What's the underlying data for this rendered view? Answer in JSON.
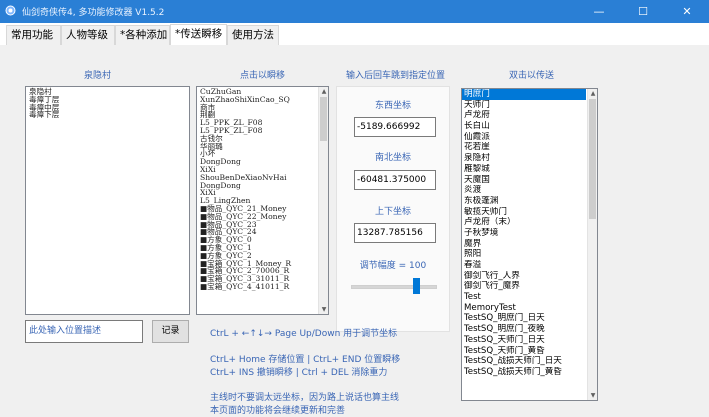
{
  "window": {
    "title": "仙剑奇侠传4, 多功能修改器  V1.5.2",
    "minimize": "—",
    "maximize": "☐",
    "close": "✕",
    "app_icon": "app-icon",
    "accent_color": "#2a7fd5"
  },
  "tabs": [
    {
      "label": "常用功能"
    },
    {
      "label": "人物等级"
    },
    {
      "label": "*各种添加"
    },
    {
      "label": "*传送瞬移"
    },
    {
      "label": "使用方法"
    }
  ],
  "headers": {
    "left": "泉隐村",
    "middle": "点击以瞬移",
    "coords": "输入后回车跳到指定位置",
    "right": "双击以传送"
  },
  "left_list": [
    "泉隐村",
    "毒瘴丁层",
    "毒瘴中层",
    "毒瘴下层"
  ],
  "middle_list": [
    "CuZhuGan",
    "XunZhaoShiXinCao_SQ",
    "商市",
    "荆蒯",
    "L5_PPK_ZL_F08",
    "L5_PPK_ZL_F08",
    "古钱尔",
    "华丽璐",
    "小坏",
    "DongDong",
    "XiXi",
    "ShouBenDeXiaoNvHai",
    "DongDong",
    "XiXi",
    "L5_LingZhen",
    "■物品_QYC_21_Money",
    "■物品_QYC_22_Money",
    "■物品_QYC_23",
    "■物品_QYC_24",
    "■方象_QYC_0",
    "■方象_QYC_1",
    "■方象_QYC_2",
    "■宝箱_QYC_1_Money_R",
    "■宝箱_QYC_2_70006_R",
    "■宝箱_QYC_3_31011_R",
    "■宝箱_QYC_4_41011_R"
  ],
  "coords": {
    "east_west_label": "东西坐标",
    "east_west_value": "-5189.666992",
    "north_south_label": "南北坐标",
    "north_south_value": "-60481.375000",
    "up_down_label": "上下坐标",
    "up_down_value": "13287.785156",
    "step_label": "调节幅度 = 100",
    "step_fraction": 0.8
  },
  "right_list": [
    "明庶门",
    "天师门",
    "卢龙府",
    "长白山",
    "仙霞派",
    "花若崖",
    "泉隐村",
    "雁黎城",
    "天魔国",
    "炎渡",
    "东极蓬渊",
    "敏揽天帅门",
    "卢龙府（末）",
    "子秋梦境",
    "魔界",
    "照阳",
    "春溢",
    "御剑飞行_人界",
    "御剑飞行_魔界",
    "Test",
    "MemoryTest",
    "TestSQ_明庶门_日天",
    "TestSQ_明庶门_夜晚",
    "TestSQ_天师门_日天",
    "TestSQ_天师门_黄昏",
    "TestSQ_战损天师门_日天",
    "TestSQ_战损天师门_黄昏"
  ],
  "selected_right_index": 0,
  "description": {
    "placeholder": "此处输入位置描述",
    "record_button": "记录"
  },
  "hints": [
    "CtrL + ←↑↓→  Page Up/Down 用于调节坐标",
    "CtrL+ Home 存储位置  |  CtrL+ END  位置瞬移",
    "CtrL+ INS    撤销瞬移  |  Ctrl + DEL  消除重力",
    "主线时不要调太远坐标，因为路上说话也算主线",
    "本页面的功能将会继续更新和完善"
  ],
  "selection_color": "#0078d7",
  "label_color": "#3a66b5"
}
